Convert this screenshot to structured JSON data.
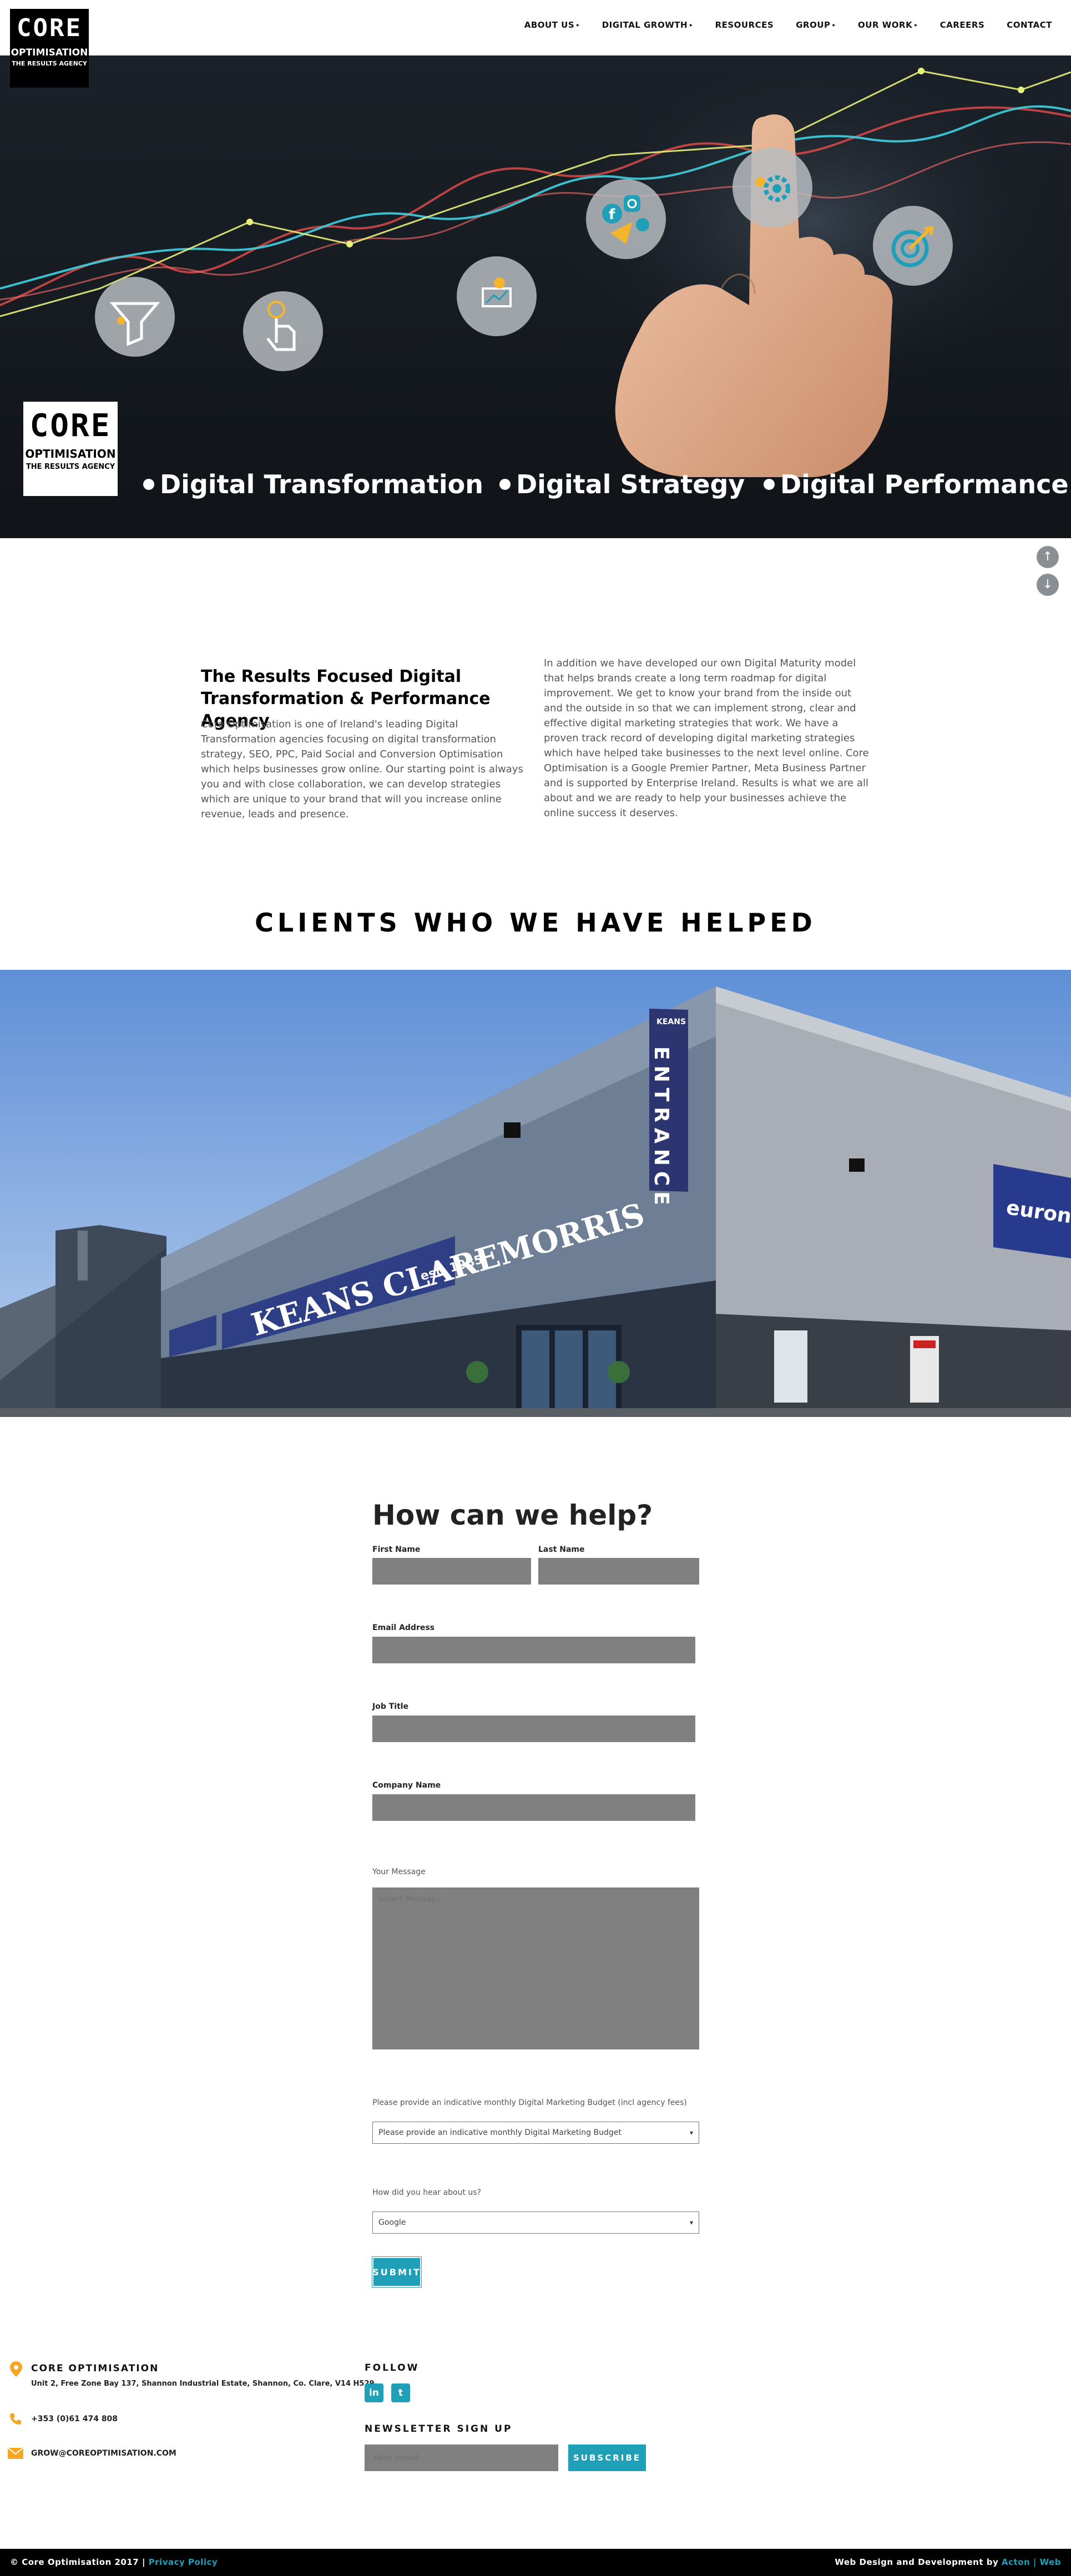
{
  "header": {
    "logo": {
      "line1": "CORE",
      "line2": "OPTIMISATION",
      "line3": "THE RESULTS AGENCY"
    },
    "nav": [
      {
        "label": "ABOUT US",
        "has_submenu": true
      },
      {
        "label": "DIGITAL GROWTH",
        "has_submenu": true
      },
      {
        "label": "RESOURCES",
        "has_submenu": false
      },
      {
        "label": "GROUP",
        "has_submenu": true
      },
      {
        "label": "OUR WORK",
        "has_submenu": true
      },
      {
        "label": "CAREERS",
        "has_submenu": false
      },
      {
        "label": "CONTACT",
        "has_submenu": false
      }
    ],
    "submenu_marker": "▸"
  },
  "hero": {
    "logo": {
      "line1": "CORE",
      "line2": "OPTIMISATION",
      "line3": "THE RESULTS AGENCY"
    },
    "taglines": [
      "Digital Transformation",
      "Digital Strategy",
      "Digital Performance"
    ],
    "icons": [
      "funnel-icon",
      "pointer-hand-icon",
      "analytics-icon",
      "social-media-icon",
      "gear-icon",
      "target-icon"
    ]
  },
  "scroll_buttons": {
    "up": "↑",
    "down": "↓"
  },
  "intro": {
    "title": "The Results Focused Digital Transformation & Performance Agency",
    "left_text": "Core Optimisation is one of Ireland's leading Digital Transformation agencies focusing on digital transformation strategy, SEO, PPC, Paid Social and Conversion Optimisation which helps businesses grow online. Our starting point is always you and with close collaboration, we can develop strategies which are unique to your brand that will you increase online revenue, leads and presence.",
    "right_text": "In addition we have developed our own Digital Maturity model that helps brands create a  long term roadmap for digital improvement.  We get to know your brand from the inside out and the outside in so that we can implement strong, clear and effective digital marketing strategies that work.  We have a proven track record of developing digital marketing strategies which have helped take businesses to the next level online. Core Optimisation is a Google Premier Partner, Meta Business Partner and is supported by Enterprise Ireland. Results is what we are all about and we are ready to help your businesses achieve the online success it deserves."
  },
  "clients": {
    "title": "CLIENTS WHO WE HAVE HELPED",
    "photo": {
      "store_sign": "KEANS CLAREMORRIS",
      "est": "est. 1985",
      "entrance_brand": "KEANS",
      "entrance": "ENTRANCE",
      "euronics": "euronics"
    }
  },
  "form": {
    "title": "How can we help?",
    "first_name_label": "First Name",
    "last_name_label": "Last Name",
    "email_label": "Email Address",
    "job_title_label": "Job Title",
    "company_label": "Company Name",
    "message_label": "Your Message",
    "message_placeholder": "Insert Message",
    "budget_label": "Please provide an indicative monthly Digital Marketing Budget (incl agency fees)",
    "budget_value": "Please provide an indicative monthly Digital Marketing Budget",
    "hear_label": "How did you hear about us?",
    "hear_value": "Google",
    "submit": "SUBMIT"
  },
  "footer": {
    "company": "CORE OPTIMISATION",
    "address": "Unit 2, Free Zone Bay 137, Shannon Industrial Estate, Shannon, Co. Clare, V14 H529",
    "phone": "+353 (0)61 474 808",
    "email": "GROW@COREOPTIMISATION.COM",
    "follow": "FOLLOW",
    "social": [
      {
        "name": "linkedin-icon",
        "glyph": "in"
      },
      {
        "name": "twitter-icon",
        "glyph": "t"
      }
    ],
    "newsletter_title": "NEWSLETTER SIGN UP",
    "newsletter_placeholder": "Your email",
    "subscribe": "SUBSCRIBE",
    "accent_color": "#1fa0b8"
  },
  "bottom_bar": {
    "copyright": "© Core Optimisation 2017 |",
    "privacy": "Privacy Policy",
    "credit": "Web Design and Development by",
    "credit_link_1": "Acton",
    "credit_sep": "|",
    "credit_link_2": "Web"
  }
}
